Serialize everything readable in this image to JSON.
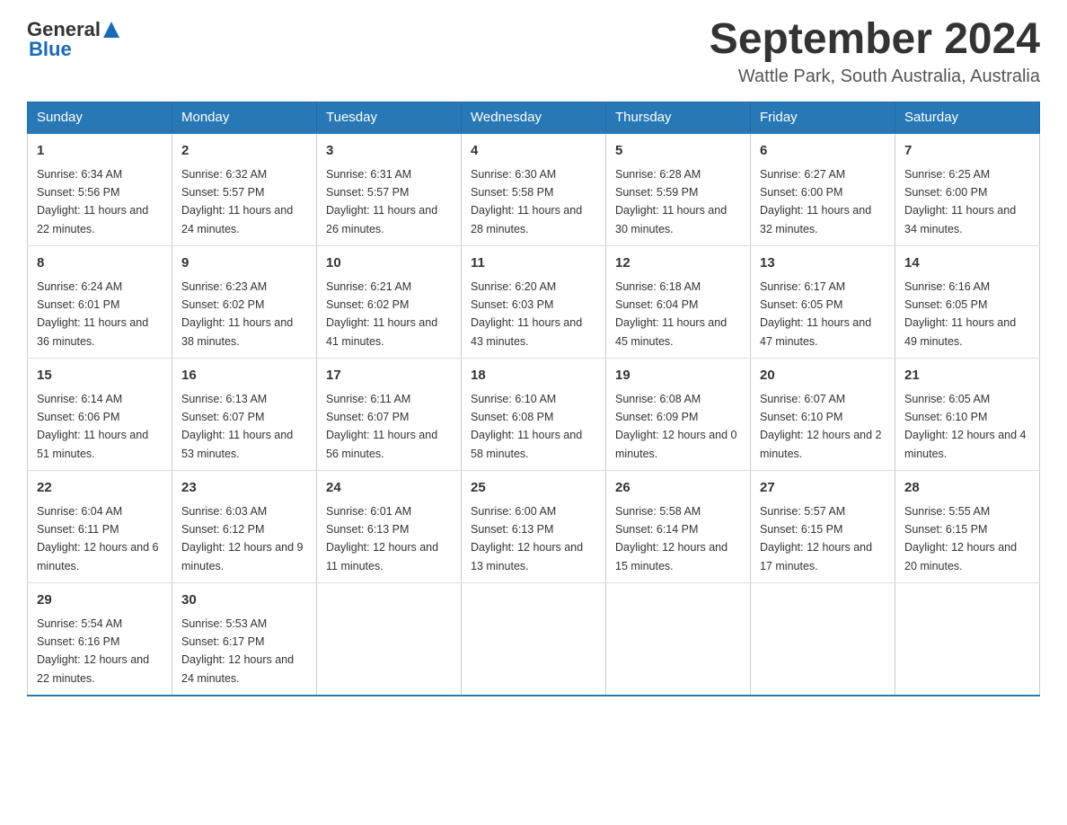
{
  "header": {
    "logo_general": "General",
    "logo_blue": "Blue",
    "month_title": "September 2024",
    "location": "Wattle Park, South Australia, Australia"
  },
  "weekdays": [
    "Sunday",
    "Monday",
    "Tuesday",
    "Wednesday",
    "Thursday",
    "Friday",
    "Saturday"
  ],
  "weeks": [
    [
      {
        "day": "1",
        "sunrise": "6:34 AM",
        "sunset": "5:56 PM",
        "daylight": "11 hours and 22 minutes."
      },
      {
        "day": "2",
        "sunrise": "6:32 AM",
        "sunset": "5:57 PM",
        "daylight": "11 hours and 24 minutes."
      },
      {
        "day": "3",
        "sunrise": "6:31 AM",
        "sunset": "5:57 PM",
        "daylight": "11 hours and 26 minutes."
      },
      {
        "day": "4",
        "sunrise": "6:30 AM",
        "sunset": "5:58 PM",
        "daylight": "11 hours and 28 minutes."
      },
      {
        "day": "5",
        "sunrise": "6:28 AM",
        "sunset": "5:59 PM",
        "daylight": "11 hours and 30 minutes."
      },
      {
        "day": "6",
        "sunrise": "6:27 AM",
        "sunset": "6:00 PM",
        "daylight": "11 hours and 32 minutes."
      },
      {
        "day": "7",
        "sunrise": "6:25 AM",
        "sunset": "6:00 PM",
        "daylight": "11 hours and 34 minutes."
      }
    ],
    [
      {
        "day": "8",
        "sunrise": "6:24 AM",
        "sunset": "6:01 PM",
        "daylight": "11 hours and 36 minutes."
      },
      {
        "day": "9",
        "sunrise": "6:23 AM",
        "sunset": "6:02 PM",
        "daylight": "11 hours and 38 minutes."
      },
      {
        "day": "10",
        "sunrise": "6:21 AM",
        "sunset": "6:02 PM",
        "daylight": "11 hours and 41 minutes."
      },
      {
        "day": "11",
        "sunrise": "6:20 AM",
        "sunset": "6:03 PM",
        "daylight": "11 hours and 43 minutes."
      },
      {
        "day": "12",
        "sunrise": "6:18 AM",
        "sunset": "6:04 PM",
        "daylight": "11 hours and 45 minutes."
      },
      {
        "day": "13",
        "sunrise": "6:17 AM",
        "sunset": "6:05 PM",
        "daylight": "11 hours and 47 minutes."
      },
      {
        "day": "14",
        "sunrise": "6:16 AM",
        "sunset": "6:05 PM",
        "daylight": "11 hours and 49 minutes."
      }
    ],
    [
      {
        "day": "15",
        "sunrise": "6:14 AM",
        "sunset": "6:06 PM",
        "daylight": "11 hours and 51 minutes."
      },
      {
        "day": "16",
        "sunrise": "6:13 AM",
        "sunset": "6:07 PM",
        "daylight": "11 hours and 53 minutes."
      },
      {
        "day": "17",
        "sunrise": "6:11 AM",
        "sunset": "6:07 PM",
        "daylight": "11 hours and 56 minutes."
      },
      {
        "day": "18",
        "sunrise": "6:10 AM",
        "sunset": "6:08 PM",
        "daylight": "11 hours and 58 minutes."
      },
      {
        "day": "19",
        "sunrise": "6:08 AM",
        "sunset": "6:09 PM",
        "daylight": "12 hours and 0 minutes."
      },
      {
        "day": "20",
        "sunrise": "6:07 AM",
        "sunset": "6:10 PM",
        "daylight": "12 hours and 2 minutes."
      },
      {
        "day": "21",
        "sunrise": "6:05 AM",
        "sunset": "6:10 PM",
        "daylight": "12 hours and 4 minutes."
      }
    ],
    [
      {
        "day": "22",
        "sunrise": "6:04 AM",
        "sunset": "6:11 PM",
        "daylight": "12 hours and 6 minutes."
      },
      {
        "day": "23",
        "sunrise": "6:03 AM",
        "sunset": "6:12 PM",
        "daylight": "12 hours and 9 minutes."
      },
      {
        "day": "24",
        "sunrise": "6:01 AM",
        "sunset": "6:13 PM",
        "daylight": "12 hours and 11 minutes."
      },
      {
        "day": "25",
        "sunrise": "6:00 AM",
        "sunset": "6:13 PM",
        "daylight": "12 hours and 13 minutes."
      },
      {
        "day": "26",
        "sunrise": "5:58 AM",
        "sunset": "6:14 PM",
        "daylight": "12 hours and 15 minutes."
      },
      {
        "day": "27",
        "sunrise": "5:57 AM",
        "sunset": "6:15 PM",
        "daylight": "12 hours and 17 minutes."
      },
      {
        "day": "28",
        "sunrise": "5:55 AM",
        "sunset": "6:15 PM",
        "daylight": "12 hours and 20 minutes."
      }
    ],
    [
      {
        "day": "29",
        "sunrise": "5:54 AM",
        "sunset": "6:16 PM",
        "daylight": "12 hours and 22 minutes."
      },
      {
        "day": "30",
        "sunrise": "5:53 AM",
        "sunset": "6:17 PM",
        "daylight": "12 hours and 24 minutes."
      },
      null,
      null,
      null,
      null,
      null
    ]
  ]
}
